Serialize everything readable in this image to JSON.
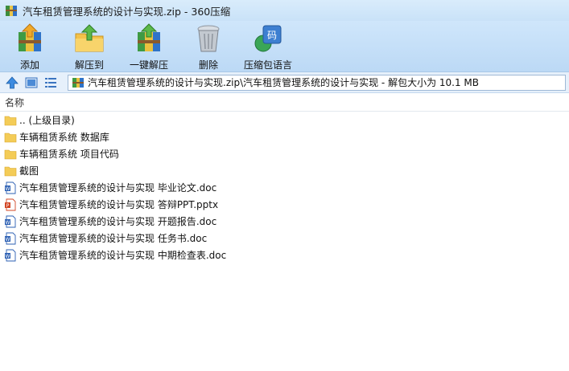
{
  "window": {
    "title": "汽车租赁管理系统的设计与实现.zip - 360压缩"
  },
  "toolbar": {
    "items": [
      {
        "label": "添加"
      },
      {
        "label": "解压到"
      },
      {
        "label": "一键解压"
      },
      {
        "label": "删除"
      },
      {
        "label": "压缩包语言"
      }
    ]
  },
  "address": {
    "path": "汽车租赁管理系统的设计与实现.zip\\汽车租赁管理系统的设计与实现 - 解包大小为 10.1 MB"
  },
  "list": {
    "column_name": "名称",
    "items": [
      {
        "name": ".. (上级目录)",
        "type": "folder"
      },
      {
        "name": "车辆租赁系统  数据库",
        "type": "folder"
      },
      {
        "name": "车辆租赁系统 项目代码",
        "type": "folder"
      },
      {
        "name": "截图",
        "type": "folder"
      },
      {
        "name": "汽车租赁管理系统的设计与实现 毕业论文.doc",
        "type": "doc"
      },
      {
        "name": "汽车租赁管理系统的设计与实现 答辩PPT.pptx",
        "type": "ppt"
      },
      {
        "name": "汽车租赁管理系统的设计与实现 开题报告.doc",
        "type": "doc"
      },
      {
        "name": "汽车租赁管理系统的设计与实现 任务书.doc",
        "type": "doc"
      },
      {
        "name": "汽车租赁管理系统的设计与实现 中期检查表.doc",
        "type": "doc"
      }
    ]
  }
}
